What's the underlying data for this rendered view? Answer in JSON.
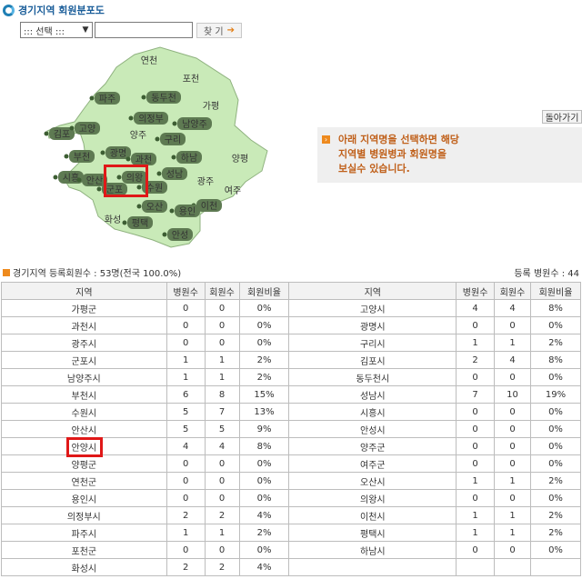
{
  "header": {
    "title": "경기지역 회원분포도"
  },
  "search": {
    "select_label": "::: 선택 :::",
    "button_label": "찾 기"
  },
  "map": {
    "regions": [
      {
        "name": "연천",
        "style": "plain"
      },
      {
        "name": "포천",
        "style": "plain"
      },
      {
        "name": "파주",
        "style": "tag"
      },
      {
        "name": "동두천",
        "style": "tag"
      },
      {
        "name": "가평",
        "style": "plain"
      },
      {
        "name": "의정부",
        "style": "tag"
      },
      {
        "name": "남양주",
        "style": "tag"
      },
      {
        "name": "김포",
        "style": "tag"
      },
      {
        "name": "고양",
        "style": "tag"
      },
      {
        "name": "양주",
        "style": "plain"
      },
      {
        "name": "구리",
        "style": "tag"
      },
      {
        "name": "부천",
        "style": "tag"
      },
      {
        "name": "광명",
        "style": "tag"
      },
      {
        "name": "하남",
        "style": "tag"
      },
      {
        "name": "양평",
        "style": "plain"
      },
      {
        "name": "과천",
        "style": "tag"
      },
      {
        "name": "시흥",
        "style": "tag"
      },
      {
        "name": "안산",
        "style": "tag"
      },
      {
        "name": "의왕",
        "style": "tag"
      },
      {
        "name": "성남",
        "style": "tag"
      },
      {
        "name": "광주",
        "style": "plain"
      },
      {
        "name": "군포",
        "style": "tag"
      },
      {
        "name": "수원",
        "style": "tag"
      },
      {
        "name": "여주",
        "style": "plain"
      },
      {
        "name": "오산",
        "style": "tag"
      },
      {
        "name": "이천",
        "style": "tag"
      },
      {
        "name": "용인",
        "style": "tag"
      },
      {
        "name": "화성",
        "style": "plain"
      },
      {
        "name": "평택",
        "style": "tag"
      },
      {
        "name": "안성",
        "style": "tag"
      }
    ]
  },
  "back_button": "돌아가기",
  "info": {
    "lines": [
      "아래 지역명을 선택하면 해당",
      "지역별 병원병과 회원명을",
      "보실수 있습니다."
    ]
  },
  "summary": {
    "text": "경기지역 등록회원수 : 53명(전국 100.0%)",
    "hospitals": "등록 병원수 : 44"
  },
  "table": {
    "headers": [
      "지역",
      "병원수",
      "회원수",
      "회원비율",
      "지역",
      "병원수",
      "회원수",
      "회원비율"
    ],
    "rows": [
      [
        "가평군",
        "0",
        "0",
        "0%",
        "고양시",
        "4",
        "4",
        "8%"
      ],
      [
        "과천시",
        "0",
        "0",
        "0%",
        "광명시",
        "0",
        "0",
        "0%"
      ],
      [
        "광주시",
        "0",
        "0",
        "0%",
        "구리시",
        "1",
        "1",
        "2%"
      ],
      [
        "군포시",
        "1",
        "1",
        "2%",
        "김포시",
        "2",
        "4",
        "8%"
      ],
      [
        "남양주시",
        "1",
        "1",
        "2%",
        "동두천시",
        "0",
        "0",
        "0%"
      ],
      [
        "부천시",
        "6",
        "8",
        "15%",
        "성남시",
        "7",
        "10",
        "19%"
      ],
      [
        "수원시",
        "5",
        "7",
        "13%",
        "시흥시",
        "0",
        "0",
        "0%"
      ],
      [
        "안산시",
        "5",
        "5",
        "9%",
        "안성시",
        "0",
        "0",
        "0%"
      ],
      [
        "안양시",
        "4",
        "4",
        "8%",
        "양주군",
        "0",
        "0",
        "0%"
      ],
      [
        "양평군",
        "0",
        "0",
        "0%",
        "여주군",
        "0",
        "0",
        "0%"
      ],
      [
        "연천군",
        "0",
        "0",
        "0%",
        "오산시",
        "1",
        "1",
        "2%"
      ],
      [
        "용인시",
        "0",
        "0",
        "0%",
        "의왕시",
        "0",
        "0",
        "0%"
      ],
      [
        "의정부시",
        "2",
        "2",
        "4%",
        "이천시",
        "1",
        "1",
        "2%"
      ],
      [
        "파주시",
        "1",
        "1",
        "2%",
        "평택시",
        "1",
        "1",
        "2%"
      ],
      [
        "포천군",
        "0",
        "0",
        "0%",
        "하남시",
        "0",
        "0",
        "0%"
      ],
      [
        "화성시",
        "2",
        "2",
        "4%",
        "",
        "",
        "",
        ""
      ]
    ]
  }
}
